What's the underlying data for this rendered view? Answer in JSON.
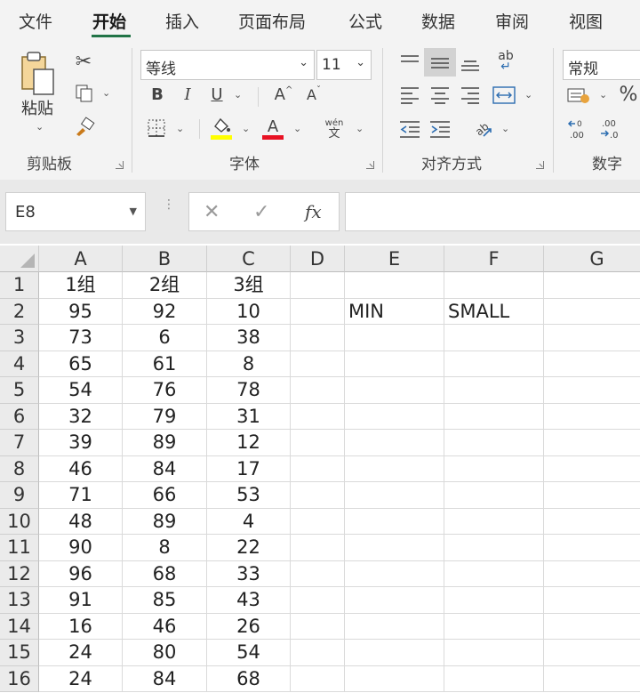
{
  "menu": {
    "tabs": [
      "文件",
      "开始",
      "插入",
      "页面布局",
      "公式",
      "数据",
      "审阅",
      "视图"
    ],
    "active": "开始"
  },
  "ribbon": {
    "clipboard": {
      "paste_label": "粘贴",
      "group_label": "剪贴板"
    },
    "font": {
      "font_name": "等线",
      "font_size": "11",
      "bold": "B",
      "italic": "I",
      "underline": "U",
      "grow": "A",
      "shrink": "A",
      "phonetic_top": "wén",
      "phonetic_bottom": "文",
      "font_color_letter": "A",
      "highlight_color": "#ffff00",
      "font_color": "#e81123",
      "group_label": "字体"
    },
    "alignment": {
      "wrap_icon": "ab",
      "group_label": "对齐方式"
    },
    "number": {
      "format": "常规",
      "percent": "%",
      "group_label": "数字"
    }
  },
  "formula_bar": {
    "name_box": "E8",
    "cancel": "✕",
    "enter": "✓",
    "fx": "fx",
    "formula": ""
  },
  "grid": {
    "columns": [
      "A",
      "B",
      "C",
      "D",
      "E",
      "F",
      "G"
    ],
    "rows": [
      {
        "n": "1",
        "A": "1组",
        "B": "2组",
        "C": "3组",
        "E": "",
        "F": ""
      },
      {
        "n": "2",
        "A": "95",
        "B": "92",
        "C": "10",
        "E": "MIN",
        "F": "SMALL"
      },
      {
        "n": "3",
        "A": "73",
        "B": "6",
        "C": "38"
      },
      {
        "n": "4",
        "A": "65",
        "B": "61",
        "C": "8"
      },
      {
        "n": "5",
        "A": "54",
        "B": "76",
        "C": "78"
      },
      {
        "n": "6",
        "A": "32",
        "B": "79",
        "C": "31"
      },
      {
        "n": "7",
        "A": "39",
        "B": "89",
        "C": "12"
      },
      {
        "n": "8",
        "A": "46",
        "B": "84",
        "C": "17"
      },
      {
        "n": "9",
        "A": "71",
        "B": "66",
        "C": "53"
      },
      {
        "n": "10",
        "A": "48",
        "B": "89",
        "C": "4"
      },
      {
        "n": "11",
        "A": "90",
        "B": "8",
        "C": "22"
      },
      {
        "n": "12",
        "A": "96",
        "B": "68",
        "C": "33"
      },
      {
        "n": "13",
        "A": "91",
        "B": "85",
        "C": "43"
      },
      {
        "n": "14",
        "A": "16",
        "B": "46",
        "C": "26"
      },
      {
        "n": "15",
        "A": "24",
        "B": "80",
        "C": "54"
      },
      {
        "n": "16",
        "A": "24",
        "B": "84",
        "C": "68"
      }
    ]
  }
}
